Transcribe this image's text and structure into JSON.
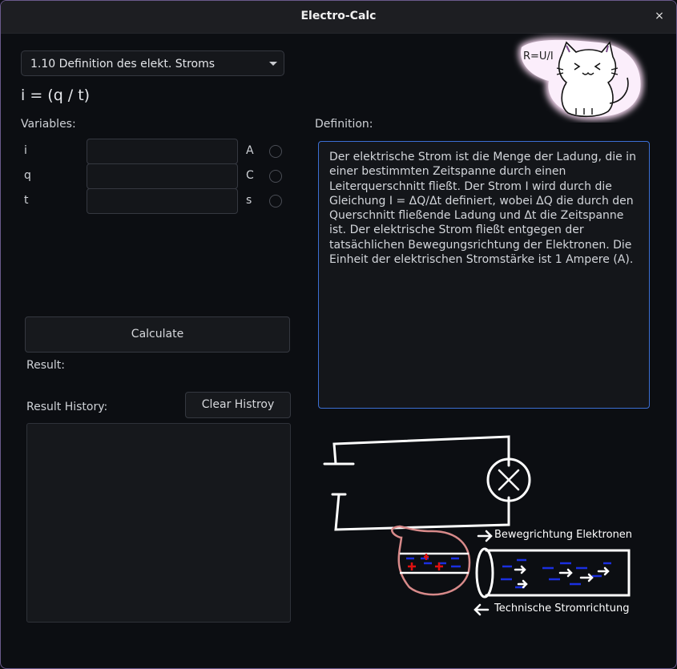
{
  "window": {
    "title": "Electro-Calc",
    "close_glyph": "×"
  },
  "formula_select": {
    "selected": "1.10 Definition des elekt. Stroms"
  },
  "formula": "i = (q / t)",
  "variables": {
    "heading": "Variables:",
    "rows": [
      {
        "name": "i",
        "value": "",
        "unit": "A"
      },
      {
        "name": "q",
        "value": "",
        "unit": "C"
      },
      {
        "name": "t",
        "value": "",
        "unit": "s"
      }
    ]
  },
  "definition": {
    "heading": "Definition:",
    "text": "Der elektrische Strom ist die Menge der Ladung, die in einer bestimmten Zeitspanne durch einen Leiterquerschnitt fließt. Der Strom I wird durch die Gleichung I = ΔQ/Δt definiert, wobei ΔQ die durch den Querschnitt fließende Ladung und Δt die Zeitspanne ist. Der elektrische Strom fließt entgegen der tatsächlichen Bewegungsrichtung der Elektronen. Die Einheit der elektrischen Stromstärke ist 1 Ampere (A)."
  },
  "actions": {
    "calculate_label": "Calculate",
    "clear_label": "Clear Histroy"
  },
  "result": {
    "label": "Result:",
    "value": ""
  },
  "history": {
    "label": "Result History:",
    "items": []
  },
  "illustration": {
    "cat_note": "R=U/I",
    "arrow_label_top": "Bewegrichtung Elektronen",
    "arrow_label_bottom": "Technische Stromrichtung"
  },
  "colors": {
    "accent": "#3b6fd4",
    "window_border": "#6b5a8c",
    "positive_charge": "#e01010",
    "negative_charge": "#1a2fe0",
    "sketch_pink": "#d88a8a"
  }
}
